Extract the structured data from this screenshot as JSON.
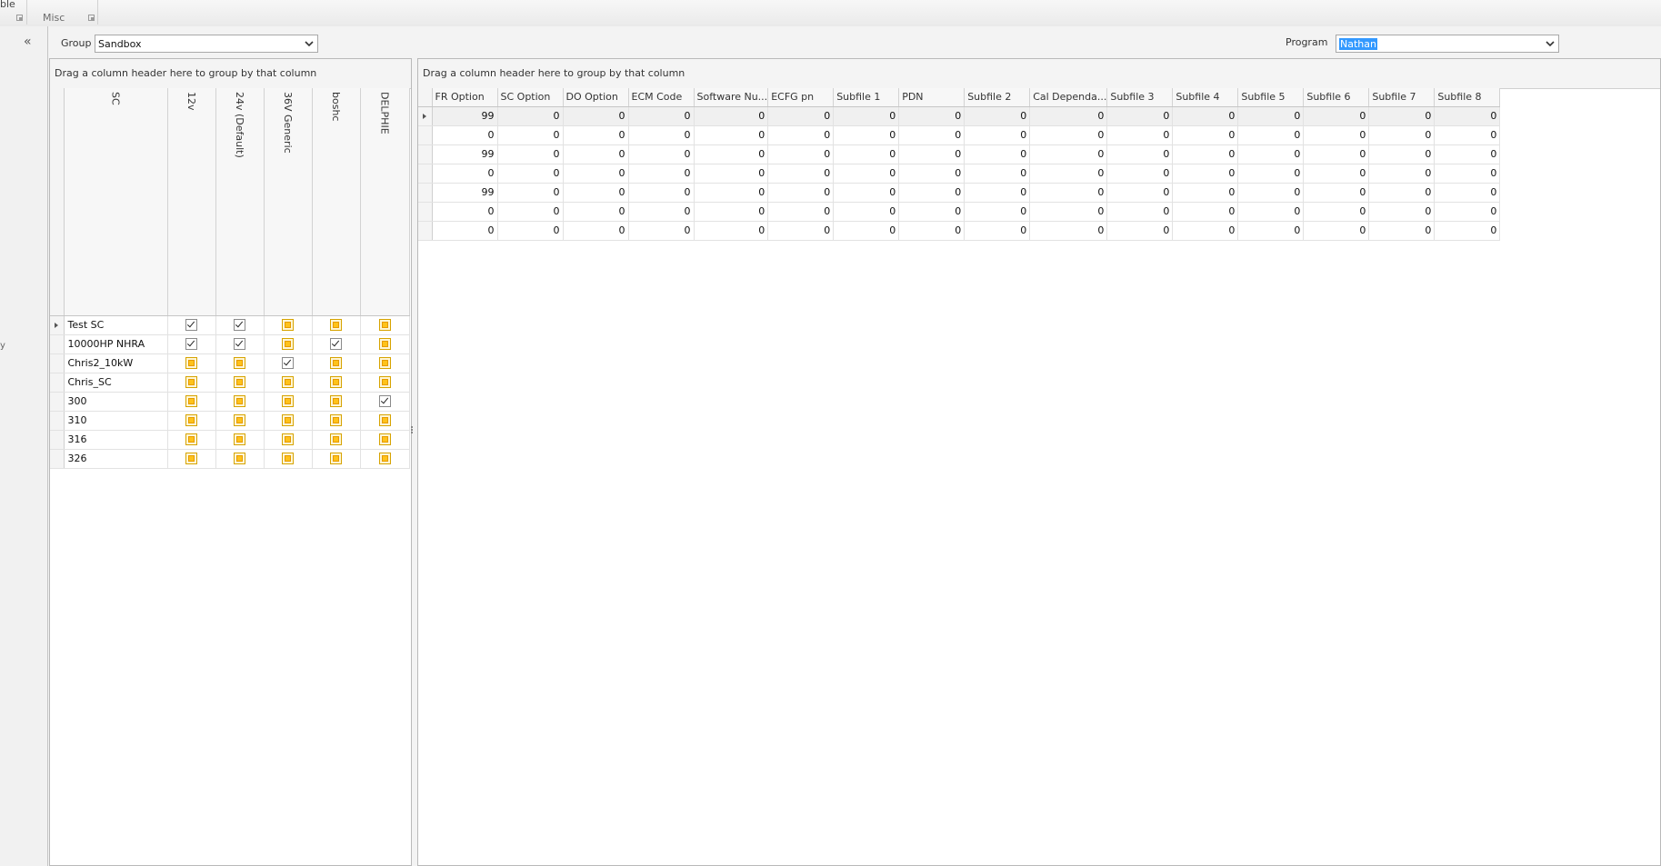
{
  "ribbon": {
    "table_label": "ble",
    "misc_label": "Misc"
  },
  "nav": {
    "collapse_glyph": "«",
    "fragment": "y"
  },
  "filters": {
    "group_label": "Group",
    "group_value": "Sandbox",
    "program_label": "Program",
    "program_value": "Nathan"
  },
  "left_grid": {
    "group_panel_text": "Drag a column header here to group by that column",
    "columns": [
      "SC",
      "12v",
      "24v (Default)",
      "36V Generic",
      "boshc",
      "DELPHIE"
    ],
    "rows": [
      {
        "name": "Test SC",
        "checks": [
          true,
          true,
          false,
          false,
          false
        ]
      },
      {
        "name": "10000HP NHRA",
        "checks": [
          true,
          true,
          false,
          true,
          false
        ]
      },
      {
        "name": "Chris2_10kW",
        "checks": [
          false,
          false,
          true,
          false,
          false
        ]
      },
      {
        "name": "Chris_SC",
        "checks": [
          false,
          false,
          false,
          false,
          false
        ]
      },
      {
        "name": "300",
        "checks": [
          false,
          false,
          false,
          false,
          true
        ]
      },
      {
        "name": "310",
        "checks": [
          false,
          false,
          false,
          false,
          false
        ]
      },
      {
        "name": "316",
        "checks": [
          false,
          false,
          false,
          false,
          false
        ]
      },
      {
        "name": "326",
        "checks": [
          false,
          false,
          false,
          false,
          false
        ]
      }
    ]
  },
  "right_grid": {
    "group_panel_text": "Drag a column header here to group by that column",
    "columns": [
      "FR Option",
      "SC Option",
      "DO Option",
      "ECM Code",
      "Software Nu...",
      "ECFG pn",
      "Subfile 1",
      "PDN",
      "Subfile 2",
      "Cal Dependa...",
      "Subfile 3",
      "Subfile 4",
      "Subfile 5",
      "Subfile 6",
      "Subfile 7",
      "Subfile 8"
    ],
    "rows": [
      [
        "99",
        "0",
        "0",
        "0",
        "0",
        "0",
        "0",
        "0",
        "0",
        "0",
        "0",
        "0",
        "0",
        "0",
        "0",
        "0"
      ],
      [
        "0",
        "0",
        "0",
        "0",
        "0",
        "0",
        "0",
        "0",
        "0",
        "0",
        "0",
        "0",
        "0",
        "0",
        "0",
        "0"
      ],
      [
        "99",
        "0",
        "0",
        "0",
        "0",
        "0",
        "0",
        "0",
        "0",
        "0",
        "0",
        "0",
        "0",
        "0",
        "0",
        "0"
      ],
      [
        "0",
        "0",
        "0",
        "0",
        "0",
        "0",
        "0",
        "0",
        "0",
        "0",
        "0",
        "0",
        "0",
        "0",
        "0",
        "0"
      ],
      [
        "99",
        "0",
        "0",
        "0",
        "0",
        "0",
        "0",
        "0",
        "0",
        "0",
        "0",
        "0",
        "0",
        "0",
        "0",
        "0"
      ],
      [
        "0",
        "0",
        "0",
        "0",
        "0",
        "0",
        "0",
        "0",
        "0",
        "0",
        "0",
        "0",
        "0",
        "0",
        "0",
        "0"
      ],
      [
        "0",
        "0",
        "0",
        "0",
        "0",
        "0",
        "0",
        "0",
        "0",
        "0",
        "0",
        "0",
        "0",
        "0",
        "0",
        "0"
      ]
    ]
  }
}
